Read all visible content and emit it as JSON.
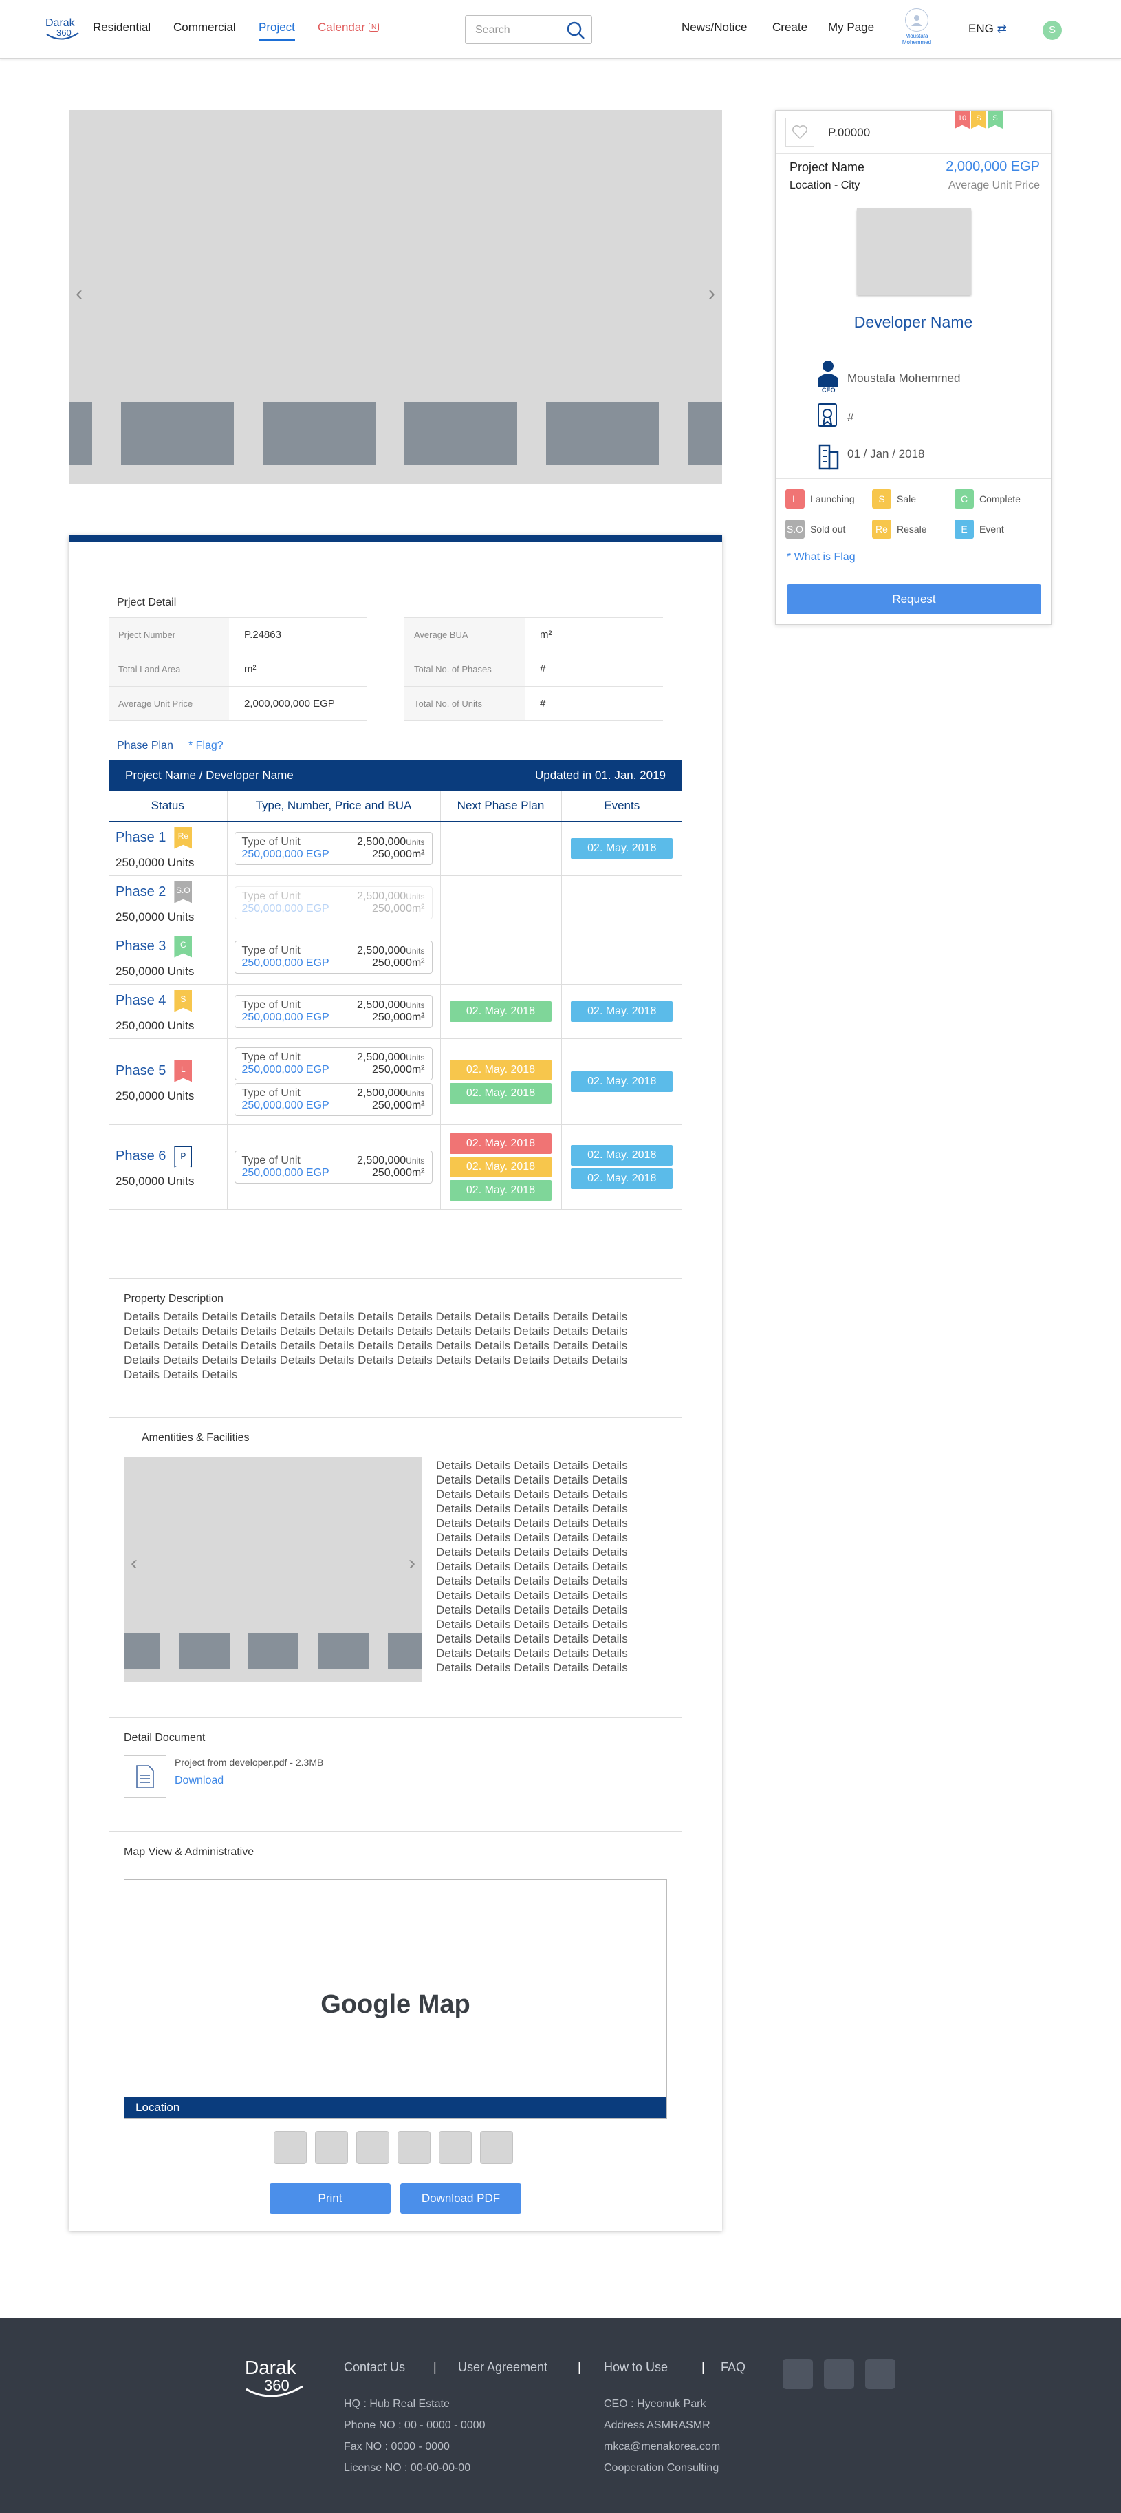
{
  "header": {
    "logo": "Darak 360",
    "nav": [
      "Residential",
      "Commercial",
      "Project",
      "Calendar"
    ],
    "calendar_badge": "N",
    "search_placeholder": "Search",
    "menu": [
      "News/Notice",
      "Create",
      "My Page"
    ],
    "user_name": "Moustafa Mohemmed",
    "lang": "ENG",
    "avatar_letter": "S"
  },
  "sidebar": {
    "code": "P.00000",
    "flags": [
      {
        "label": "10",
        "color": "#f07474"
      },
      {
        "label": "S",
        "color": "#f7c64c"
      },
      {
        "label": "S",
        "color": "#7fd699"
      }
    ],
    "project_name": "Project Name",
    "price": "2,000,000 EGP",
    "location": "Location - City",
    "price_label": "Average Unit Price",
    "developer": "Developer Name",
    "ceo_label": "CEO",
    "ceo_name": "Moustafa Mohemmed",
    "license": "#",
    "date": "01 / Jan / 2018",
    "legend": [
      {
        "code": "L",
        "label": "Launching",
        "color": "#f07474"
      },
      {
        "code": "S",
        "label": "Sale",
        "color": "#f7c64c"
      },
      {
        "code": "C",
        "label": "Complete",
        "color": "#7fd699"
      },
      {
        "code": "S.O",
        "label": "Sold out",
        "color": "#adadad"
      },
      {
        "code": "Re",
        "label": "Resale",
        "color": "#f7c64c"
      },
      {
        "code": "E",
        "label": "Event",
        "color": "#5bbbe9"
      }
    ],
    "flag_link": "* What is Flag",
    "request": "Request"
  },
  "detail": {
    "title": "Prject Detail",
    "left": [
      {
        "k": "Prject Number",
        "v": "P.24863"
      },
      {
        "k": "Total Land Area",
        "v": "m²"
      },
      {
        "k": "Average Unit Price",
        "v": "2,000,000,000 EGP"
      }
    ],
    "right": [
      {
        "k": "Average BUA",
        "v": "m²"
      },
      {
        "k": "Total No. of Phases",
        "v": "#"
      },
      {
        "k": "Total No. of Units",
        "v": "#"
      }
    ]
  },
  "phase": {
    "title": "Phase Plan",
    "flag_q": "* Flag?",
    "header_left": "Project Name / Developer Name",
    "header_right": "Updated in 01. Jan. 2019",
    "cols": [
      "Status",
      "Type, Number, Price and BUA",
      "Next Phase Plan",
      "Events"
    ],
    "unit": {
      "type": "Type of Unit",
      "count": "2,500,000",
      "count_unit": "Units",
      "price": "250,000,000 EGP",
      "bua": "250,000m²"
    },
    "rows": [
      {
        "name": "Phase 1",
        "flag": "Re",
        "flag_color": "#f7c64c",
        "units": "250,0000 Units",
        "boxes": [
          ""
        ],
        "next": [],
        "events": [
          "02. May. 2018"
        ]
      },
      {
        "name": "Phase 2",
        "flag": "S.O",
        "flag_color": "#adadad",
        "units": "250,0000 Units",
        "boxes": [
          "faded"
        ],
        "next": [],
        "events": []
      },
      {
        "name": "Phase 3",
        "flag": "C",
        "flag_color": "#7fd699",
        "units": "250,0000 Units",
        "boxes": [
          ""
        ],
        "next": [],
        "events": []
      },
      {
        "name": "Phase 4",
        "flag": "S",
        "flag_color": "#f7c64c",
        "units": "250,0000 Units",
        "boxes": [
          ""
        ],
        "next": [
          {
            "t": "02. May. 2018",
            "c": "#7fd699"
          }
        ],
        "events": [
          "02. May. 2018"
        ]
      },
      {
        "name": "Phase 5",
        "flag": "L",
        "flag_color": "#f07474",
        "units": "250,0000 Units",
        "boxes": [
          "",
          ""
        ],
        "next": [
          {
            "t": "02. May. 2018",
            "c": "#f7c64c"
          },
          {
            "t": "02. May. 2018",
            "c": "#7fd699"
          }
        ],
        "events": [
          "02. May. 2018"
        ]
      },
      {
        "name": "Phase 6",
        "flag": "P",
        "flag_color": "outline",
        "units": "250,0000 Units",
        "boxes": [
          ""
        ],
        "next": [
          {
            "t": "02. May. 2018",
            "c": "#f07474"
          },
          {
            "t": "02. May. 2018",
            "c": "#f7c64c"
          },
          {
            "t": "02. May. 2018",
            "c": "#7fd699"
          }
        ],
        "events": [
          "02. May. 2018",
          "02. May. 2018"
        ]
      }
    ]
  },
  "description": {
    "title": "Property Description",
    "lines": [
      "Details Details Details Details Details Details Details Details Details Details Details Details Details",
      "Details Details Details Details Details Details Details Details Details Details Details Details Details",
      "Details Details Details Details Details Details Details Details Details Details Details Details Details",
      "Details Details Details Details Details Details Details Details Details Details Details Details Details",
      "Details Details Details"
    ]
  },
  "amenities": {
    "title": "Amentities & Facilities",
    "lines": [
      "Details Details Details Details Details",
      "Details Details Details Details Details",
      "Details Details Details Details Details",
      "Details Details Details Details Details",
      "Details Details Details Details Details",
      "Details Details Details Details Details",
      "Details Details Details Details Details",
      "Details Details Details Details Details",
      "Details Details Details Details Details",
      "Details Details Details Details Details",
      "Details Details Details Details Details",
      "Details Details Details Details Details",
      "Details Details Details Details Details",
      "Details Details Details Details Details",
      "Details Details Details Details Details"
    ]
  },
  "document": {
    "title": "Detail Document",
    "file": "Project from developer.pdf - 2.3MB",
    "download": "Download"
  },
  "map": {
    "title": "Map View & Administrative",
    "placeholder": "Google Map",
    "location": "Location"
  },
  "actions": {
    "print": "Print",
    "pdf": "Download PDF"
  },
  "footer": {
    "logo": "Darak 360",
    "links": [
      "Contact Us",
      "User Agreement",
      "How to Use",
      "FAQ"
    ],
    "left": [
      "HQ : Hub Real Estate",
      "Phone NO : 00 - 0000 - 0000",
      "Fax NO : 0000 - 0000",
      "License NO : 00-00-00-00"
    ],
    "right": [
      "CEO : Hyeonuk Park",
      "Address ASMRASMR",
      "mkca@menakorea.com",
      "Cooperation Consulting"
    ]
  }
}
